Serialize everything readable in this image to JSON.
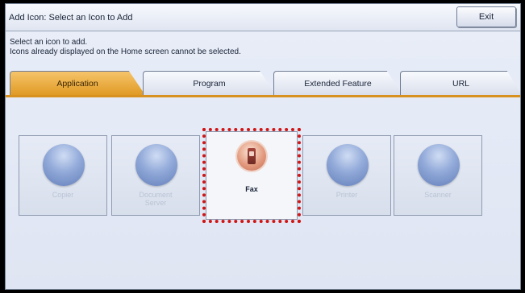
{
  "header": {
    "title": "Add Icon: Select an Icon to Add",
    "exit_label": "Exit"
  },
  "instructions": {
    "line1": "Select an icon to add.",
    "line2": "Icons already displayed on the Home screen cannot be selected."
  },
  "tabs": [
    {
      "label": "Application",
      "active": true
    },
    {
      "label": "Program",
      "active": false
    },
    {
      "label": "Extended Feature",
      "active": false
    },
    {
      "label": "URL",
      "active": false
    }
  ],
  "icons": [
    {
      "label_line1": "Copier",
      "label_line2": "",
      "icon": "circle-icon",
      "enabled": false
    },
    {
      "label_line1": "Document",
      "label_line2": "Server",
      "icon": "circle-icon",
      "enabled": false
    },
    {
      "label_line1": "Fax",
      "label_line2": "",
      "icon": "fax-icon",
      "enabled": true,
      "highlighted": true
    },
    {
      "label_line1": "Printer",
      "label_line2": "",
      "icon": "circle-icon",
      "enabled": false
    },
    {
      "label_line1": "Scanner",
      "label_line2": "",
      "icon": "circle-icon",
      "enabled": false
    }
  ],
  "colors": {
    "active_tab": "#e09a24",
    "highlight": "#d11414",
    "disabled_orb": "#6f89c4"
  }
}
